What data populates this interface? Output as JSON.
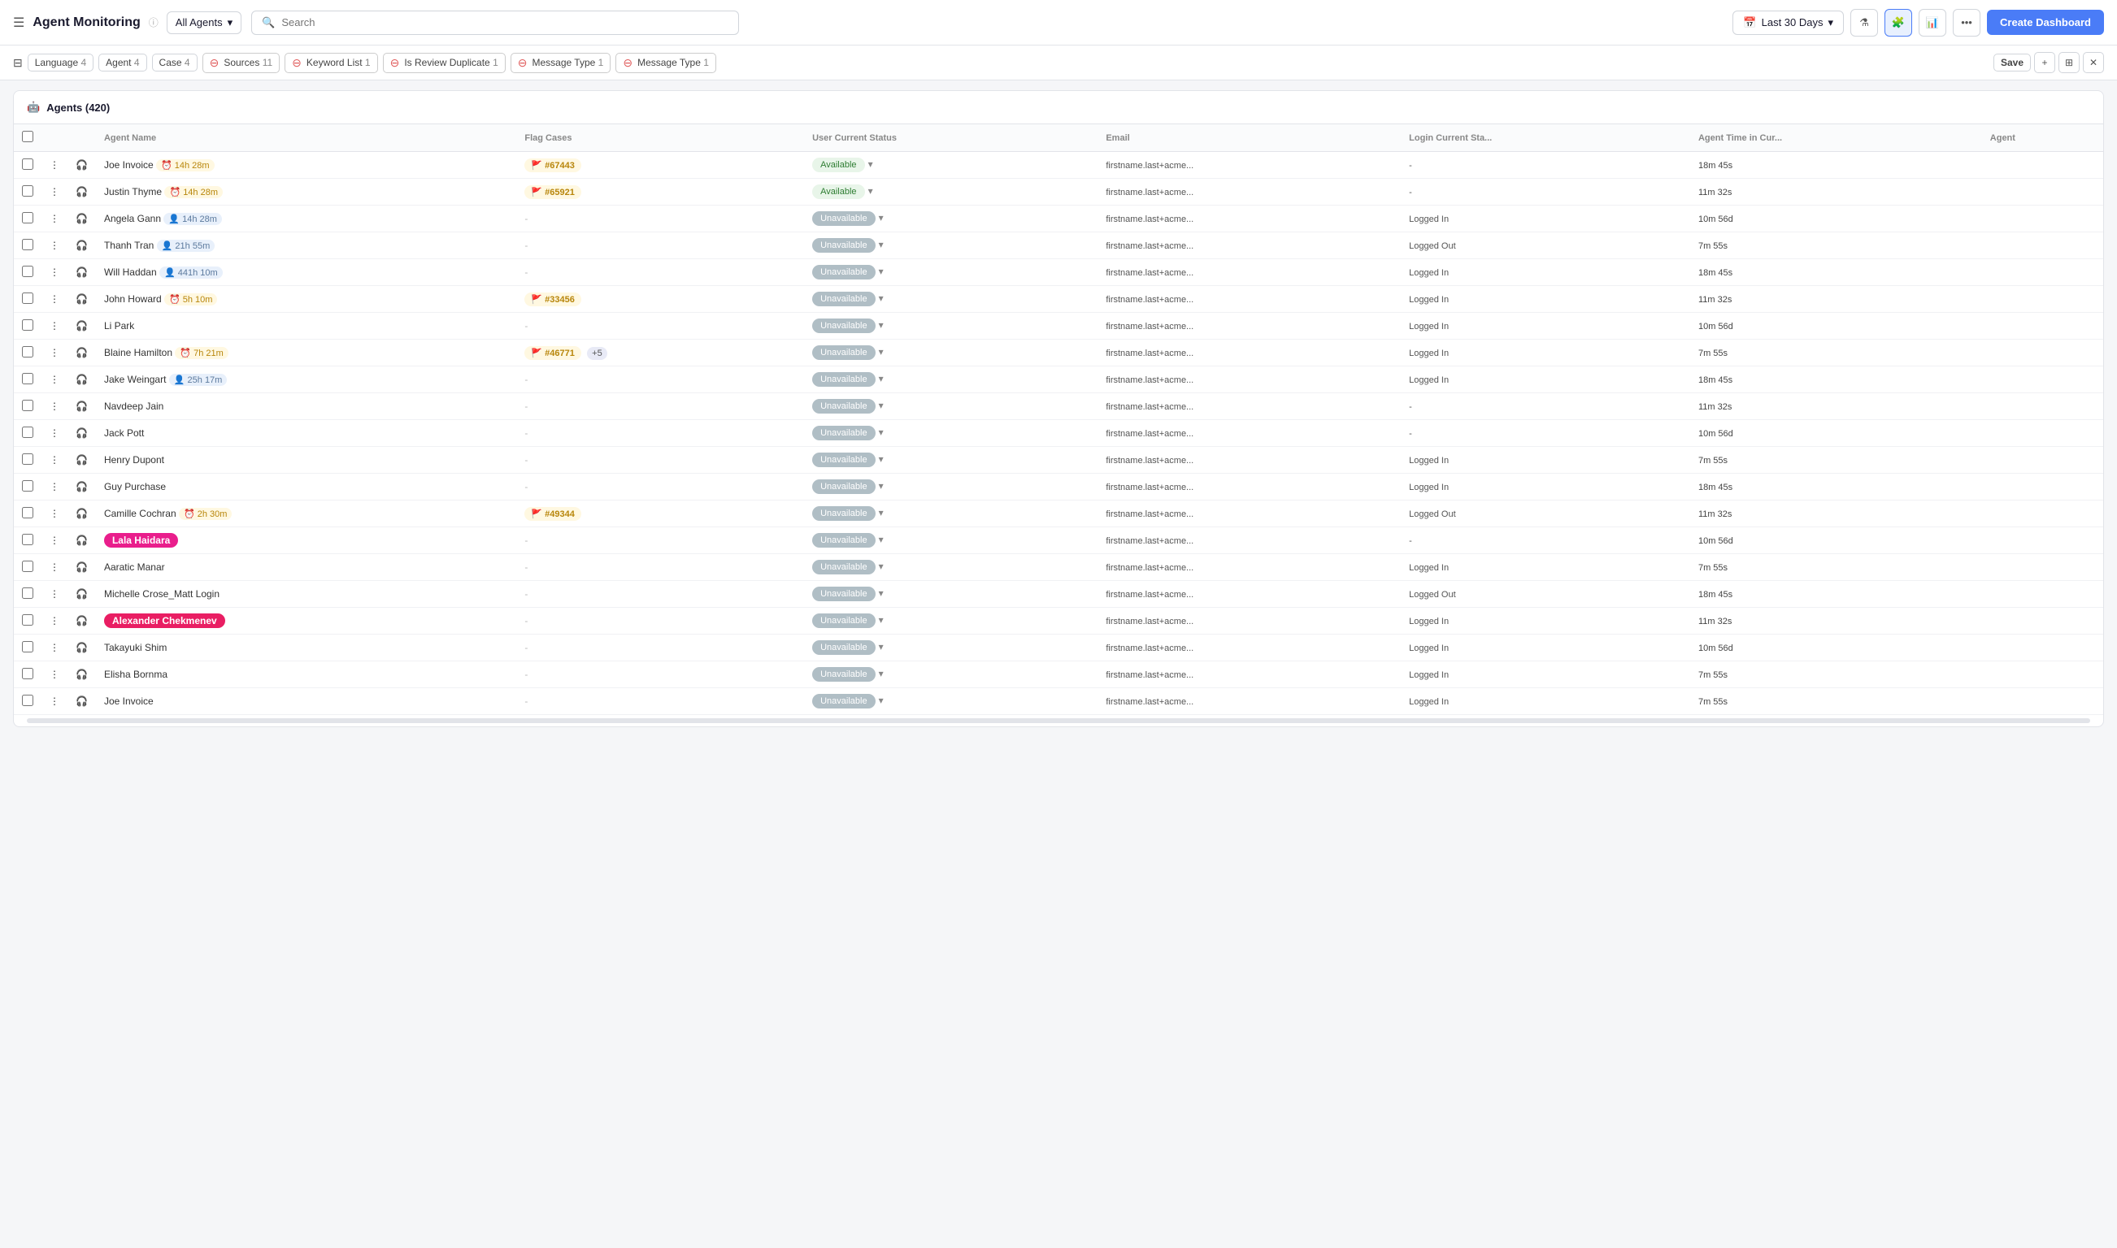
{
  "header": {
    "menu_icon": "☰",
    "title": "Agent Monitoring",
    "info_icon": "ℹ",
    "agents_dropdown": "All Agents",
    "search_placeholder": "Search",
    "date_range": "Last 30 Days",
    "create_dashboard_label": "Create Dashboard"
  },
  "filter_bar": {
    "chips": [
      {
        "label": "Language",
        "count": "4",
        "removable": false
      },
      {
        "label": "Agent",
        "count": "4",
        "removable": false
      },
      {
        "label": "Case",
        "count": "4",
        "removable": false
      },
      {
        "label": "Sources",
        "count": "11",
        "removable": true
      },
      {
        "label": "Keyword List",
        "count": "1",
        "removable": true
      },
      {
        "label": "Is Review Duplicate",
        "count": "1",
        "removable": true
      },
      {
        "label": "Message Type",
        "count": "1",
        "removable": true
      },
      {
        "label": "Message Type",
        "count": "1",
        "removable": true
      }
    ],
    "save_label": "Save"
  },
  "table": {
    "title": "Agents",
    "count": "420",
    "columns": [
      "",
      "",
      "",
      "Agent Name",
      "Flag Cases",
      "User Current Status",
      "Email",
      "Login Current Status",
      "Agent Time in Current",
      "Agent"
    ],
    "rows": [
      {
        "name": "Joe Invoice",
        "timer": "14h 28m",
        "timer_type": "normal",
        "flag": "#67443",
        "status": "Available",
        "email": "firstname.last+acme...",
        "login": "-",
        "time": "18m 45s",
        "highlight": ""
      },
      {
        "name": "Justin Thyme",
        "timer": "14h 28m",
        "timer_type": "normal",
        "flag": "#65921",
        "status": "Available",
        "email": "firstname.last+acme...",
        "login": "-",
        "time": "11m 32s",
        "highlight": ""
      },
      {
        "name": "Angela Gann",
        "timer": "14h 28m",
        "timer_type": "person",
        "flag": "-",
        "status": "Unavailable",
        "email": "firstname.last+acme...",
        "login": "Logged In",
        "time": "10m 56d",
        "highlight": ""
      },
      {
        "name": "Thanh Tran",
        "timer": "21h 55m",
        "timer_type": "person",
        "flag": "-",
        "status": "Unavailable",
        "email": "firstname.last+acme...",
        "login": "Logged Out",
        "time": "7m 55s",
        "highlight": ""
      },
      {
        "name": "Will Haddan",
        "timer": "441h 10m",
        "timer_type": "person",
        "flag": "-",
        "status": "Unavailable",
        "email": "firstname.last+acme...",
        "login": "Logged In",
        "time": "18m 45s",
        "highlight": ""
      },
      {
        "name": "John Howard",
        "timer": "5h 10m",
        "timer_type": "normal",
        "flag": "#33456",
        "status": "Unavailable",
        "email": "firstname.last+acme...",
        "login": "Logged In",
        "time": "11m 32s",
        "highlight": ""
      },
      {
        "name": "Li Park",
        "timer": "",
        "timer_type": "",
        "flag": "-",
        "status": "Unavailable",
        "email": "firstname.last+acme...",
        "login": "Logged In",
        "time": "10m 56d",
        "highlight": ""
      },
      {
        "name": "Blaine Hamilton",
        "timer": "7h 21m",
        "timer_type": "normal",
        "flag": "#46771",
        "flag_extra": "+5",
        "status": "Unavailable",
        "email": "firstname.last+acme...",
        "login": "Logged In",
        "time": "7m 55s",
        "highlight": ""
      },
      {
        "name": "Jake Weingart",
        "timer": "25h 17m",
        "timer_type": "person",
        "flag": "-",
        "status": "Unavailable",
        "email": "firstname.last+acme...",
        "login": "Logged In",
        "time": "18m 45s",
        "highlight": ""
      },
      {
        "name": "Navdeep Jain",
        "timer": "",
        "timer_type": "",
        "flag": "-",
        "status": "Unavailable",
        "email": "firstname.last+acme...",
        "login": "-",
        "time": "11m 32s",
        "highlight": ""
      },
      {
        "name": "Jack Pott",
        "timer": "",
        "timer_type": "",
        "flag": "-",
        "status": "Unavailable",
        "email": "firstname.last+acme...",
        "login": "-",
        "time": "10m 56d",
        "highlight": ""
      },
      {
        "name": "Henry Dupont",
        "timer": "",
        "timer_type": "",
        "flag": "-",
        "status": "Unavailable",
        "email": "firstname.last+acme...",
        "login": "Logged In",
        "time": "7m 55s",
        "highlight": ""
      },
      {
        "name": "Guy Purchase",
        "timer": "",
        "timer_type": "",
        "flag": "-",
        "status": "Unavailable",
        "email": "firstname.last+acme...",
        "login": "Logged In",
        "time": "18m 45s",
        "highlight": ""
      },
      {
        "name": "Camille Cochran",
        "timer": "2h 30m",
        "timer_type": "normal",
        "flag": "#49344",
        "status": "Unavailable",
        "email": "firstname.last+acme...",
        "login": "Logged Out",
        "time": "11m 32s",
        "highlight": ""
      },
      {
        "name": "Lala Haidara",
        "timer": "",
        "timer_type": "",
        "flag": "-",
        "status": "Unavailable",
        "email": "firstname.last+acme...",
        "login": "-",
        "time": "10m 56d",
        "highlight": "pink"
      },
      {
        "name": "Aaratic Manar",
        "timer": "",
        "timer_type": "",
        "flag": "-",
        "status": "Unavailable",
        "email": "firstname.last+acme...",
        "login": "Logged In",
        "time": "7m 55s",
        "highlight": ""
      },
      {
        "name": "Michelle Crose_Matt Login",
        "timer": "",
        "timer_type": "",
        "flag": "-",
        "status": "Unavailable",
        "email": "firstname.last+acme...",
        "login": "Logged Out",
        "time": "18m 45s",
        "highlight": ""
      },
      {
        "name": "Alexander Chekmenev",
        "timer": "",
        "timer_type": "",
        "flag": "-",
        "status": "Unavailable",
        "email": "firstname.last+acme...",
        "login": "Logged In",
        "time": "11m 32s",
        "highlight": "red"
      },
      {
        "name": "Takayuki Shim",
        "timer": "",
        "timer_type": "",
        "flag": "-",
        "status": "Unavailable",
        "email": "firstname.last+acme...",
        "login": "Logged In",
        "time": "10m 56d",
        "highlight": ""
      },
      {
        "name": "Elisha Bornma",
        "timer": "",
        "timer_type": "",
        "flag": "-",
        "status": "Unavailable",
        "email": "firstname.last+acme...",
        "login": "Logged In",
        "time": "7m 55s",
        "highlight": ""
      },
      {
        "name": "Joe Invoice",
        "timer": "",
        "timer_type": "",
        "flag": "-",
        "status": "Unavailable",
        "email": "firstname.last+acme...",
        "login": "Logged In",
        "time": "7m 55s",
        "highlight": ""
      }
    ]
  }
}
